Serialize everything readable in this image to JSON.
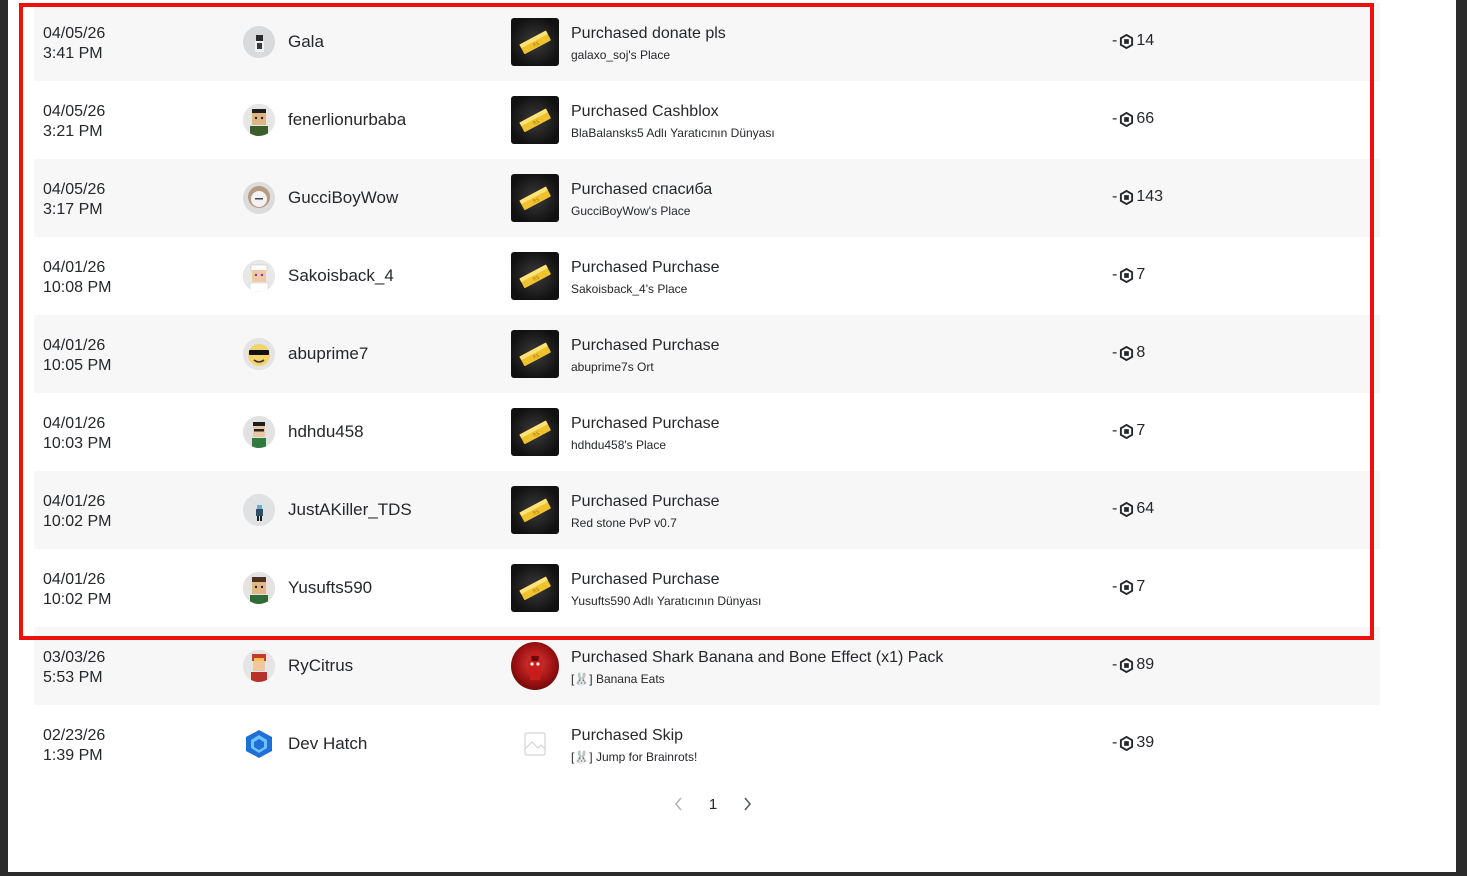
{
  "rows": [
    {
      "date": "04/05/26",
      "time": "3:41 PM",
      "user": "Gala",
      "avatar": "avatar-gala",
      "title": "Purchased donate pls",
      "place": "galaxo_soj's Place",
      "sign": "-",
      "amount": "14"
    },
    {
      "date": "04/05/26",
      "time": "3:21 PM",
      "user": "fenerlionurbaba",
      "avatar": "avatar-fener",
      "title": "Purchased Cashblox",
      "place": "BlaBalansks5 Adlı Yaratıcının Dünyası",
      "sign": "-",
      "amount": "66"
    },
    {
      "date": "04/05/26",
      "time": "3:17 PM",
      "user": "GucciBoyWow",
      "avatar": "avatar-gucci",
      "title": "Purchased спасиба",
      "place": "GucciBoyWow's Place",
      "sign": "-",
      "amount": "143"
    },
    {
      "date": "04/01/26",
      "time": "10:08 PM",
      "user": "Sakoisback_4",
      "avatar": "avatar-sako",
      "title": "Purchased Purchase",
      "place": "Sakoisback_4's Place",
      "sign": "-",
      "amount": "7"
    },
    {
      "date": "04/01/26",
      "time": "10:05 PM",
      "user": "abuprime7",
      "avatar": "avatar-abu",
      "title": "Purchased Purchase",
      "place": "abuprime7s Ort",
      "sign": "-",
      "amount": "8"
    },
    {
      "date": "04/01/26",
      "time": "10:03 PM",
      "user": "hdhdu458",
      "avatar": "avatar-hdhdu",
      "title": "Purchased Purchase",
      "place": "hdhdu458's Place",
      "sign": "-",
      "amount": "7"
    },
    {
      "date": "04/01/26",
      "time": "10:02 PM",
      "user": "JustAKiller_TDS",
      "avatar": "avatar-just",
      "title": "Purchased Purchase",
      "place": "Red stone PvP v0.7",
      "sign": "-",
      "amount": "64"
    },
    {
      "date": "04/01/26",
      "time": "10:02 PM",
      "user": "Yusufts590",
      "avatar": "avatar-yusuf",
      "title": "Purchased Purchase",
      "place": "Yusufts590 Adlı Yaratıcının Dünyası",
      "sign": "-",
      "amount": "7"
    },
    {
      "date": "03/03/26",
      "time": "5:53 PM",
      "user": "RyCitrus",
      "avatar": "avatar-rycitrus",
      "title": "Purchased Shark Banana and Bone Effect (x1) Pack",
      "place": "[🐰] Banana Eats",
      "sign": "-",
      "amount": "89"
    },
    {
      "date": "02/23/26",
      "time": "1:39 PM",
      "user": "Dev Hatch",
      "avatar": "avatar-devhatch",
      "title": "Purchased Skip",
      "place": "[🐰] Jump for Brainrots!",
      "sign": "-",
      "amount": "39"
    }
  ],
  "pagination": {
    "current_page": "1"
  },
  "icons": {
    "currency": "robux-icon",
    "prev": "chevron-left-icon",
    "next": "chevron-right-icon",
    "item_thumb": "gold-bar-icon"
  },
  "colors": {
    "highlight_border": "#ee0f0f",
    "row_shade": "#f7f7f8"
  }
}
